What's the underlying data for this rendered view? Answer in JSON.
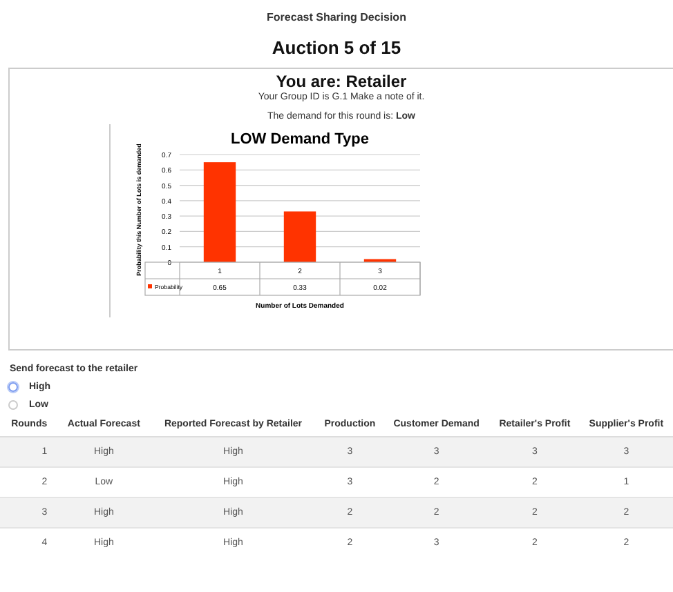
{
  "page_title": "Forecast Sharing Decision",
  "auction": "Auction 5 of 15",
  "panel": {
    "role": "You are: Retailer",
    "group_note": "Your Group ID is G.1 Make a note of it.",
    "demand_label": "The demand for this round is:",
    "demand_value": "Low",
    "chart_data": {
      "type": "bar",
      "title": "LOW Demand Type",
      "xlabel": "Number of Lots Demanded",
      "ylabel": "Probability this Number of Lots is demanded",
      "categories": [
        "1",
        "2",
        "3"
      ],
      "series": [
        {
          "name": "Probability",
          "color": "#ff3300",
          "values": [
            0.65,
            0.33,
            0.02
          ]
        }
      ],
      "ylim": [
        0,
        0.7
      ],
      "yticks": [
        0,
        0.1,
        0.2,
        0.3,
        0.4,
        0.5,
        0.6,
        0.7
      ],
      "data_labels": true,
      "grid": true
    }
  },
  "forecast": {
    "label": "Send forecast to the retailer",
    "options": [
      {
        "label": "High",
        "selected": false,
        "focused": true
      },
      {
        "label": "Low",
        "selected": false,
        "focused": false
      }
    ]
  },
  "table": {
    "columns": [
      "Rounds",
      "Actual Forecast",
      "Reported Forecast by Retailer",
      "Production",
      "Customer Demand",
      "Retailer's Profit",
      "Supplier's Profit"
    ],
    "rows": [
      [
        "1",
        "High",
        "High",
        "3",
        "3",
        "3",
        "3"
      ],
      [
        "2",
        "Low",
        "High",
        "3",
        "2",
        "2",
        "1"
      ],
      [
        "3",
        "High",
        "High",
        "2",
        "2",
        "2",
        "2"
      ],
      [
        "4",
        "High",
        "High",
        "2",
        "3",
        "2",
        "2"
      ]
    ]
  }
}
